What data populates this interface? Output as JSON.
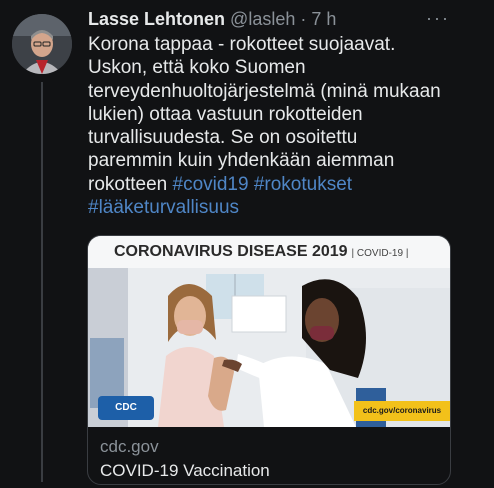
{
  "tweet": {
    "author_name": "Lasse Lehtonen",
    "handle": "@lasleh",
    "separator": "·",
    "time": "7 h",
    "more": "···",
    "lines": [
      "Korona tappaa - rokotteet suojaavat.",
      "Uskon, että koko Suomen",
      "terveydenhuoltojärjestelmä (minä mukaan",
      "lukien) ottaa vastuun rokotteiden",
      "turvallisuudesta. Se on osoitettu",
      "paremmin kuin yhdenkään aiemman"
    ],
    "last_line_text": "rokotteen ",
    "hashtags": [
      "#covid19",
      "#rokotukset",
      "#lääketurvallisuus"
    ]
  },
  "card": {
    "banner_title": "CORONAVIRUS DISEASE 2019",
    "banner_sub": "| COVID-19 |",
    "cdc_logo_text": "CDC",
    "image_url_text": "cdc.gov/coronavirus",
    "domain": "cdc.gov",
    "title": "COVID-19 Vaccination"
  },
  "colors": {
    "background": "#111214",
    "hashtag": "#4f86c6",
    "muted": "#8b9299",
    "cdc_blue": "#1d5fa8",
    "cdc_yellow": "#f2c11a"
  }
}
